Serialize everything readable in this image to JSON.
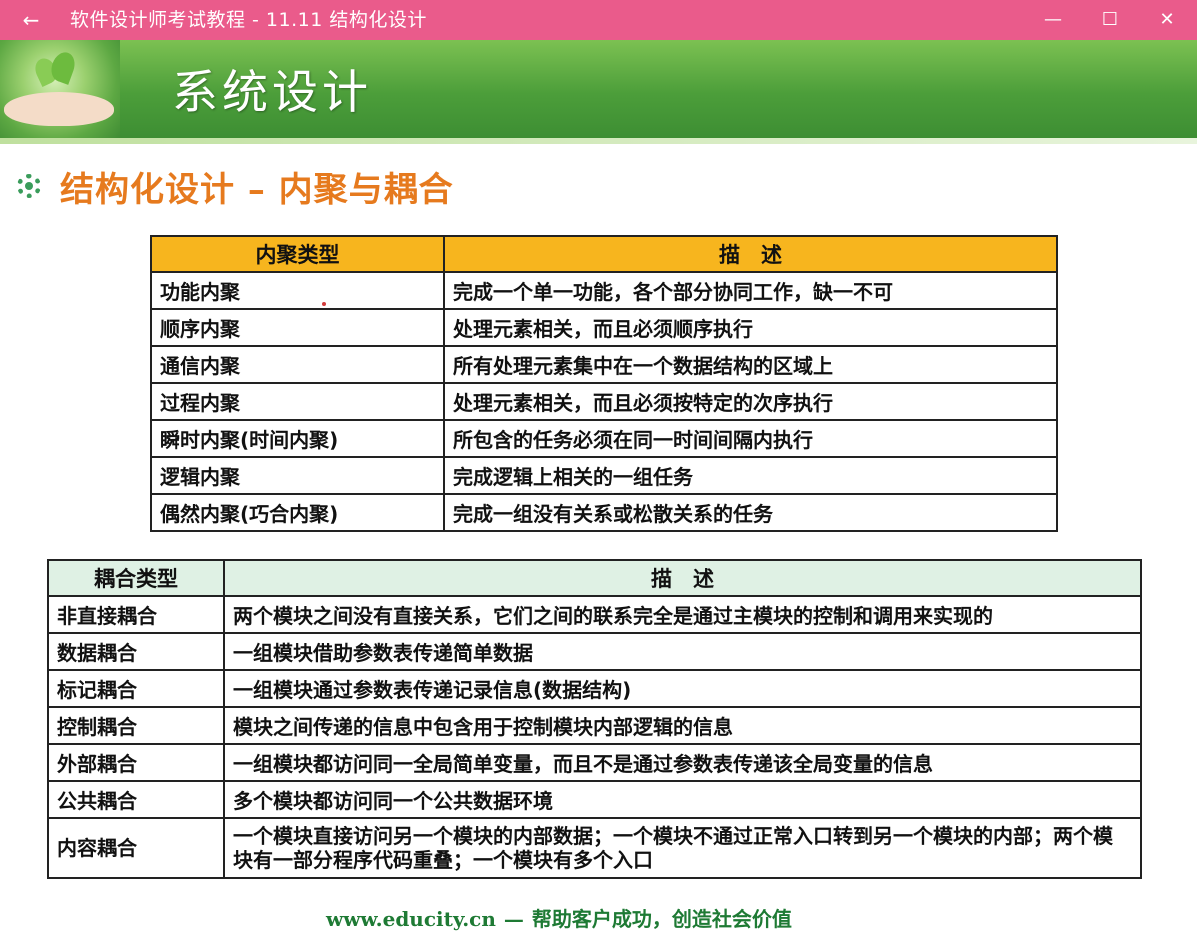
{
  "window": {
    "title": "软件设计师考试教程 - 11.11  结构化设计",
    "back_icon": "←",
    "minimize_icon": "—",
    "maximize_icon": "☐",
    "close_icon": "✕"
  },
  "slide": {
    "heading": "系统设计",
    "subheading": "结构化设计 – 内聚与耦合",
    "cohesion_table": {
      "headers": [
        "内聚类型",
        "描　述"
      ],
      "rows": [
        [
          "功能内聚",
          "完成一个单一功能，各个部分协同工作，缺一不可"
        ],
        [
          "顺序内聚",
          "处理元素相关，而且必须顺序执行"
        ],
        [
          "通信内聚",
          "所有处理元素集中在一个数据结构的区域上"
        ],
        [
          "过程内聚",
          "处理元素相关，而且必须按特定的次序执行"
        ],
        [
          "瞬时内聚(时间内聚)",
          "所包含的任务必须在同一时间间隔内执行"
        ],
        [
          "逻辑内聚",
          "完成逻辑上相关的一组任务"
        ],
        [
          "偶然内聚(巧合内聚)",
          "完成一组没有关系或松散关系的任务"
        ]
      ]
    },
    "coupling_table": {
      "headers": [
        "耦合类型",
        "描　述"
      ],
      "rows": [
        [
          "非直接耦合",
          "两个模块之间没有直接关系，它们之间的联系完全是通过主模块的控制和调用来实现的"
        ],
        [
          "数据耦合",
          "一组模块借助参数表传递简单数据"
        ],
        [
          "标记耦合",
          "一组模块通过参数表传递记录信息(数据结构)"
        ],
        [
          "控制耦合",
          "模块之间传递的信息中包含用于控制模块内部逻辑的信息"
        ],
        [
          "外部耦合",
          "一组模块都访问同一全局简单变量，而且不是通过参数表传递该全局变量的信息"
        ],
        [
          "公共耦合",
          "多个模块都访问同一个公共数据环境"
        ],
        [
          "内容耦合",
          "一个模块直接访问另一个模块的内部数据；一个模块不通过正常入口转到另一个模块的内部；两个模块有一部分程序代码重叠；一个模块有多个入口"
        ]
      ]
    },
    "footer": {
      "url": "www.educity.cn",
      "dash": "—",
      "slogan": "帮助客户成功，创造社会价值"
    }
  },
  "colors": {
    "titlebar": "#ea5b8b",
    "banner": "#4c9e3a",
    "subheading": "#e67a1e",
    "cohesion_header": "#f7b51e",
    "coupling_header": "#dff1e4",
    "footer": "#1e7a34"
  }
}
